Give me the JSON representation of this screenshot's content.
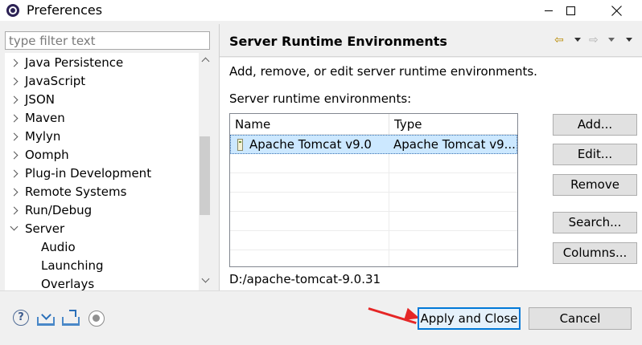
{
  "window": {
    "title": "Preferences",
    "icon": "eclipse-icon"
  },
  "filter": {
    "placeholder": "type filter text",
    "value": ""
  },
  "tree": {
    "items": [
      {
        "label": "Java Persistence",
        "expanded": false
      },
      {
        "label": "JavaScript",
        "expanded": false
      },
      {
        "label": "JSON",
        "expanded": false
      },
      {
        "label": "Maven",
        "expanded": false
      },
      {
        "label": "Mylyn",
        "expanded": false
      },
      {
        "label": "Oomph",
        "expanded": false
      },
      {
        "label": "Plug-in Development",
        "expanded": false
      },
      {
        "label": "Remote Systems",
        "expanded": false
      },
      {
        "label": "Run/Debug",
        "expanded": false
      },
      {
        "label": "Server",
        "expanded": true
      },
      {
        "label": "Audio",
        "child": true
      },
      {
        "label": "Launching",
        "child": true
      },
      {
        "label": "Overlays",
        "child": true
      }
    ]
  },
  "page": {
    "title": "Server Runtime Environments",
    "description": "Add, remove, or edit server runtime environments.",
    "list_label": "Server runtime environments:",
    "table": {
      "columns": [
        "Name",
        "Type"
      ],
      "rows": [
        {
          "name": "Apache Tomcat v9.0",
          "type": "Apache Tomcat v9...",
          "selected": true
        }
      ]
    },
    "location": "D:/apache-tomcat-9.0.31",
    "buttons": {
      "add": "Add...",
      "edit": "Edit...",
      "remove": "Remove",
      "search": "Search...",
      "columns": "Columns..."
    }
  },
  "nav": {
    "back": "⇦",
    "forward": "⇨"
  },
  "footer": {
    "apply_close": "Apply and Close",
    "cancel": "Cancel",
    "help_glyph": "?"
  },
  "colors": {
    "accent": "#0078d7",
    "selection": "#cce8ff",
    "annotation_arrow": "#e52626"
  }
}
